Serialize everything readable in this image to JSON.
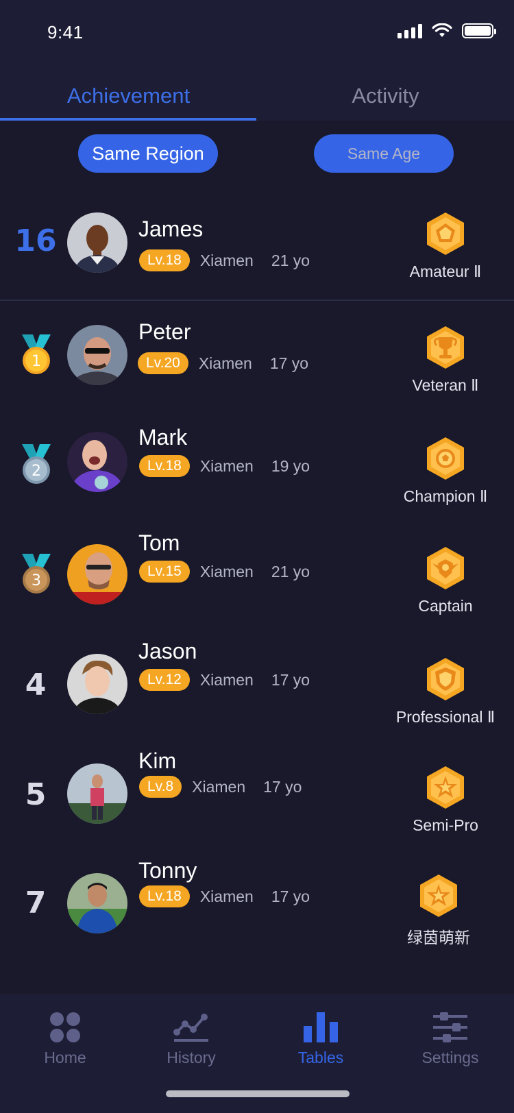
{
  "status_bar": {
    "time": "9:41"
  },
  "tabs": [
    {
      "label": "Achievement",
      "active": true
    },
    {
      "label": "Activity",
      "active": false
    }
  ],
  "filters": {
    "region": "Same Region",
    "age": "Same Age"
  },
  "my_entry": {
    "rank": "16",
    "name": "James",
    "level": "Lv.18",
    "city": "Xiamen",
    "age": "21 yo",
    "title": "Amateur Ⅱ",
    "badge": "pentagon-badge-icon"
  },
  "leaderboard": [
    {
      "rank": "1",
      "medal": "gold",
      "name": "Peter",
      "level": "Lv.20",
      "city": "Xiamen",
      "age": "17 yo",
      "title": "Veteran Ⅱ",
      "badge": "trophy-badge-icon"
    },
    {
      "rank": "2",
      "medal": "silver",
      "name": "Mark",
      "level": "Lv.18",
      "city": "Xiamen",
      "age": "19 yo",
      "title": "Champion Ⅱ",
      "badge": "ball-badge-icon"
    },
    {
      "rank": "3",
      "medal": "bronze",
      "name": "Tom",
      "level": "Lv.15",
      "city": "Xiamen",
      "age": "21 yo",
      "title": "Captain",
      "badge": "wings-badge-icon"
    },
    {
      "rank": "4",
      "name": "Jason",
      "level": "Lv.12",
      "city": "Xiamen",
      "age": "17 yo",
      "title": "Professional Ⅱ",
      "badge": "shield-badge-icon"
    },
    {
      "rank": "5",
      "name": "Kim",
      "level": "Lv.8",
      "city": "Xiamen",
      "age": "17 yo",
      "title": "Semi-Pro",
      "badge": "star-badge-icon"
    },
    {
      "rank": "7",
      "name": "Tonny",
      "level": "Lv.18",
      "city": "Xiamen",
      "age": "17 yo",
      "title": "绿茵萌新",
      "badge": "star-badge-icon"
    }
  ],
  "tabbar": [
    {
      "label": "Home",
      "icon": "home-icon",
      "active": false
    },
    {
      "label": "History",
      "icon": "history-icon",
      "active": false
    },
    {
      "label": "Tables",
      "icon": "tables-icon",
      "active": true
    },
    {
      "label": "Settings",
      "icon": "settings-icon",
      "active": false
    }
  ],
  "colors": {
    "background": "#19192b",
    "panel": "#1d1e36",
    "accent": "#3565e6",
    "level_badge": "#f5a623",
    "gold": "#f5a623"
  }
}
